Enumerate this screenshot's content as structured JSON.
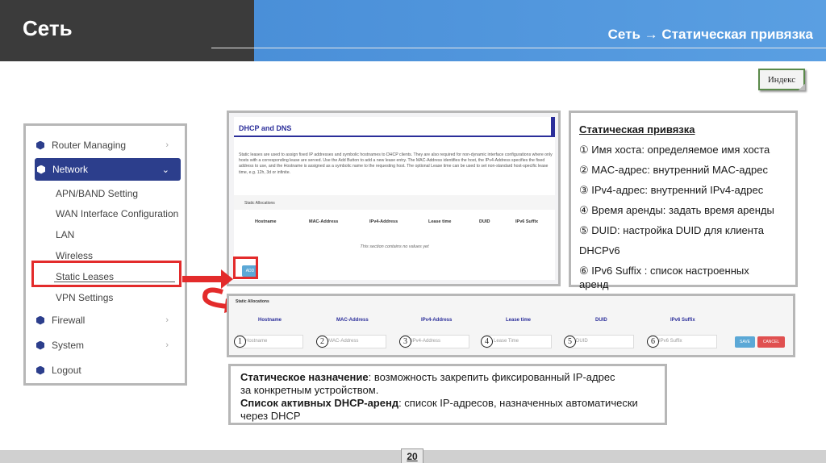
{
  "header": {
    "title": "Сеть",
    "subtitle": "Сеть → Статическая привязка"
  },
  "index_button": "Индекс",
  "sidebar": {
    "items": [
      {
        "label": "Router Managing",
        "chevron": "›"
      },
      {
        "label": "Network",
        "chevron": "⌄"
      },
      {
        "label": "Firewall",
        "chevron": "›"
      },
      {
        "label": "System",
        "chevron": "›"
      },
      {
        "label": "Logout"
      }
    ],
    "subitems": [
      "APN/BAND Setting",
      "WAN Interface Configuration",
      "LAN",
      "Wireless",
      "Static Leases",
      "VPN Settings"
    ]
  },
  "panel1": {
    "title": "DHCP and DNS",
    "description": "Static leases are used to assign fixed IP addresses and symbolic hostnames to DHCP clients. They are also required for non-dynamic interface configurations where only hosts with a corresponding lease are served. Use the Add Button to add a new lease entry. The MAC-Address identifies the host, the IPv4-Address specifies the fixed address to use, and the Hostname is assigned as a symbolic name to the requesting host. The optional Lease time can be used to set non-standard host-specific lease time, e.g. 12h, 3d or infinite.",
    "section": "Static Allocations",
    "columns": [
      "Hostname",
      "MAC-Address",
      "IPv4-Address",
      "Lease time",
      "DUID",
      "IPv6 Suffix"
    ],
    "empty": "This section contains no values yet",
    "add_label": "ADD"
  },
  "description": {
    "title": "Статическая привязка",
    "items": [
      "① Имя хоста: определяемое имя хоста",
      "② MAC-адрес: внутренний MAC-адрес",
      "③ IPv4-адрес: внутренний IPv4-адрес",
      "④ Время аренды: задать время аренды",
      "⑤ DUID: настройка DUID для клиента",
      "DHCPv6",
      "⑥ IPv6 Suffix : список настроенных",
      "аренд"
    ]
  },
  "panel2": {
    "section": "Static Allocations",
    "columns": [
      "Hostname",
      "MAC-Address",
      "IPv4-Address",
      "Lease time",
      "DUID",
      "IPv6 Suffix"
    ],
    "placeholders": [
      "Hostname",
      "MAC-Address",
      "IPv4-Address",
      "Lease Time",
      "DUID",
      "IPv6 Suffix"
    ],
    "numbers": [
      "1",
      "2",
      "3",
      "4",
      "5",
      "6"
    ],
    "save_label": "SAVE",
    "cancel_label": "CANCEL"
  },
  "notes": {
    "line1_bold": "Статическое назначение",
    "line1_rest": ": возможность закрепить фиксированный IP-адрес",
    "line2": "за конкретным устройством.",
    "line3_bold": "Список активных DHCP-аренд",
    "line3_rest": ": список IP-адресов, назначенных автоматически",
    "line4": "через DHCP"
  },
  "footer": {
    "page": "20"
  },
  "colors": {
    "header_dark": "#3b3b3b",
    "header_blue": "#4a8fd8",
    "nav_active": "#2c3e8c",
    "highlight_red": "#e32b2b",
    "save_blue": "#5ba8d6",
    "cancel_red": "#e05050"
  }
}
